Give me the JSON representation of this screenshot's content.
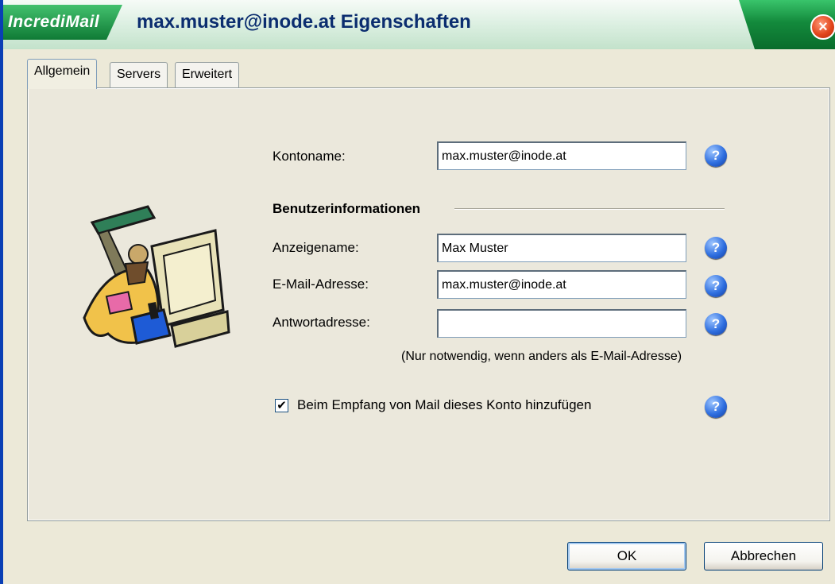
{
  "window": {
    "brand": "IncrediMail",
    "title": "max.muster@inode.at Eigenschaften",
    "close_glyph": "×"
  },
  "tabs": [
    {
      "label": "Allgemein",
      "active": true
    },
    {
      "label": "Servers",
      "active": false
    },
    {
      "label": "Erweitert",
      "active": false
    }
  ],
  "form": {
    "kontoname_label": "Kontoname:",
    "kontoname_value": "max.muster@inode.at",
    "group_title": "Benutzerinformationen",
    "anzeigename_label": "Anzeigename:",
    "anzeigename_value": "Max Muster",
    "email_label": "E-Mail-Adresse:",
    "email_value": "max.muster@inode.at",
    "antwort_label": "Antwortadresse:",
    "antwort_value": "",
    "antwort_note": "(Nur notwendig, wenn anders als E-Mail-Adresse)",
    "checkbox_label": "Beim Empfang von Mail dieses Konto hinzufügen",
    "checkbox_checked": true,
    "help_glyph": "?"
  },
  "buttons": {
    "ok": "OK",
    "cancel": "Abbrechen"
  },
  "colors": {
    "title_green": "#138a3c",
    "help_blue": "#2f6fe0",
    "close_red": "#e2461c"
  },
  "icons": {
    "illustration": "computer-mail-illustration-icon",
    "help": "help-icon",
    "close": "close-icon"
  }
}
